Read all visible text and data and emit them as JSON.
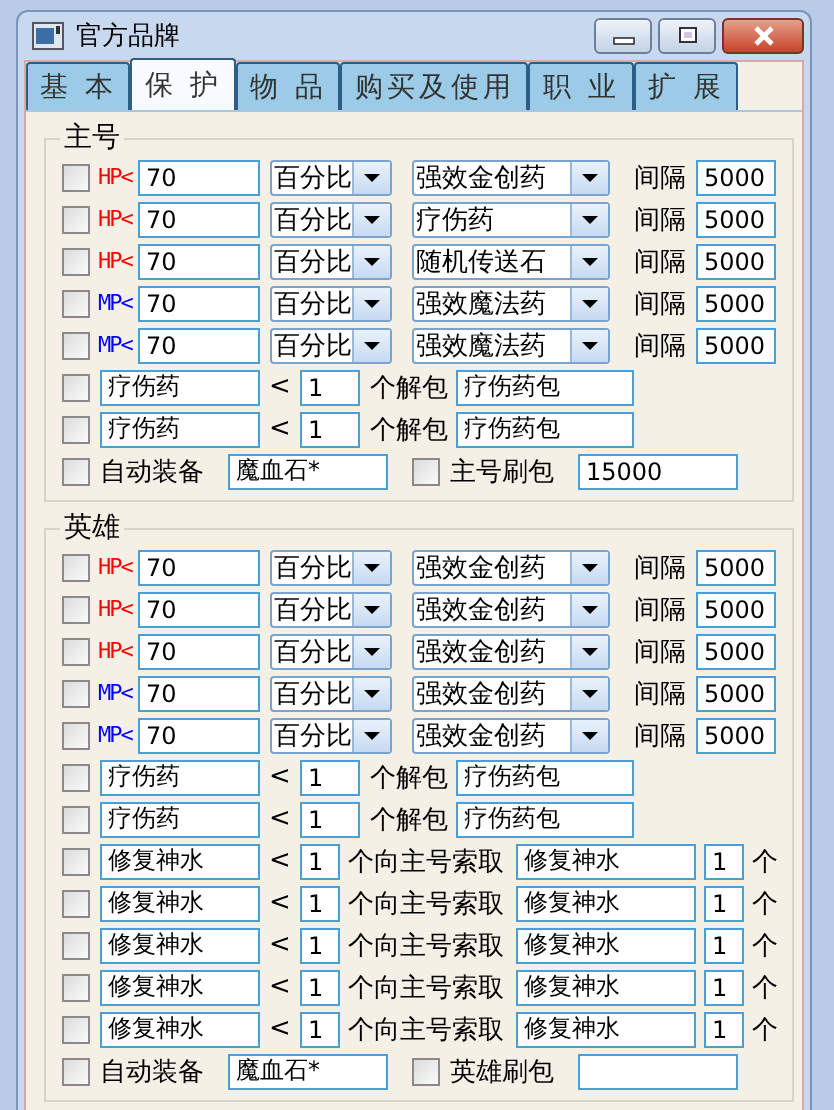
{
  "window": {
    "title": "官方品牌"
  },
  "tabs": [
    {
      "label": "基 本",
      "selected": false
    },
    {
      "label": "保 护",
      "selected": true
    },
    {
      "label": "物 品",
      "selected": false
    },
    {
      "label": "购买及使用",
      "selected": false
    },
    {
      "label": "职  业",
      "selected": false
    },
    {
      "label": "扩  展",
      "selected": false
    }
  ],
  "groups": [
    {
      "title": "主号",
      "threshold_rows": [
        {
          "checked": false,
          "label": "HP<",
          "color": "#ff0000",
          "value": "70",
          "mode": "百分比",
          "item": "强效金创药",
          "interval_label": "间隔",
          "interval": "5000"
        },
        {
          "checked": false,
          "label": "HP<",
          "color": "#ff0000",
          "value": "70",
          "mode": "百分比",
          "item": "疗伤药",
          "interval_label": "间隔",
          "interval": "5000"
        },
        {
          "checked": false,
          "label": "HP<",
          "color": "#ff0000",
          "value": "70",
          "mode": "百分比",
          "item": "随机传送石",
          "interval_label": "间隔",
          "interval": "5000"
        },
        {
          "checked": false,
          "label": "MP<",
          "color": "#0000ff",
          "value": "70",
          "mode": "百分比",
          "item": "强效魔法药",
          "interval_label": "间隔",
          "interval": "5000"
        },
        {
          "checked": false,
          "label": "MP<",
          "color": "#0000ff",
          "value": "70",
          "mode": "百分比",
          "item": "强效魔法药",
          "interval_label": "间隔",
          "interval": "5000"
        }
      ],
      "unpack_rows": [
        {
          "checked": false,
          "item": "疗伤药",
          "op": "<",
          "count": "1",
          "action": "个解包",
          "bag": "疗伤药包"
        },
        {
          "checked": false,
          "item": "疗伤药",
          "op": "<",
          "count": "1",
          "action": "个解包",
          "bag": "疗伤药包"
        }
      ],
      "auto_equip": {
        "checked": false,
        "label": "自动装备",
        "value": "魔血石*"
      },
      "refill": {
        "checked": false,
        "label": "主号刷包",
        "value": "15000"
      }
    },
    {
      "title": "英雄",
      "threshold_rows": [
        {
          "checked": false,
          "label": "HP<",
          "color": "#ff0000",
          "value": "70",
          "mode": "百分比",
          "item": "强效金创药",
          "interval_label": "间隔",
          "interval": "5000"
        },
        {
          "checked": false,
          "label": "HP<",
          "color": "#ff0000",
          "value": "70",
          "mode": "百分比",
          "item": "强效金创药",
          "interval_label": "间隔",
          "interval": "5000"
        },
        {
          "checked": false,
          "label": "HP<",
          "color": "#ff0000",
          "value": "70",
          "mode": "百分比",
          "item": "强效金创药",
          "interval_label": "间隔",
          "interval": "5000"
        },
        {
          "checked": false,
          "label": "MP<",
          "color": "#0000ff",
          "value": "70",
          "mode": "百分比",
          "item": "强效金创药",
          "interval_label": "间隔",
          "interval": "5000"
        },
        {
          "checked": false,
          "label": "MP<",
          "color": "#0000ff",
          "value": "70",
          "mode": "百分比",
          "item": "强效金创药",
          "interval_label": "间隔",
          "interval": "5000"
        }
      ],
      "unpack_rows": [
        {
          "checked": false,
          "item": "疗伤药",
          "op": "<",
          "count": "1",
          "action": "个解包",
          "bag": "疗伤药包"
        },
        {
          "checked": false,
          "item": "疗伤药",
          "op": "<",
          "count": "1",
          "action": "个解包",
          "bag": "疗伤药包"
        }
      ],
      "request_rows": [
        {
          "checked": false,
          "item": "修复神水",
          "op": "<",
          "count": "1",
          "action": "个向主号索取",
          "request_item": "修复神水",
          "request_count": "1",
          "unit": "个"
        },
        {
          "checked": false,
          "item": "修复神水",
          "op": "<",
          "count": "1",
          "action": "个向主号索取",
          "request_item": "修复神水",
          "request_count": "1",
          "unit": "个"
        },
        {
          "checked": false,
          "item": "修复神水",
          "op": "<",
          "count": "1",
          "action": "个向主号索取",
          "request_item": "修复神水",
          "request_count": "1",
          "unit": "个"
        },
        {
          "checked": false,
          "item": "修复神水",
          "op": "<",
          "count": "1",
          "action": "个向主号索取",
          "request_item": "修复神水",
          "request_count": "1",
          "unit": "个"
        },
        {
          "checked": false,
          "item": "修复神水",
          "op": "<",
          "count": "1",
          "action": "个向主号索取",
          "request_item": "修复神水",
          "request_count": "1",
          "unit": "个"
        }
      ],
      "auto_equip": {
        "checked": false,
        "label": "自动装备",
        "value": "魔血石*"
      },
      "refill": {
        "checked": false,
        "label": "英雄刷包"
      }
    }
  ]
}
